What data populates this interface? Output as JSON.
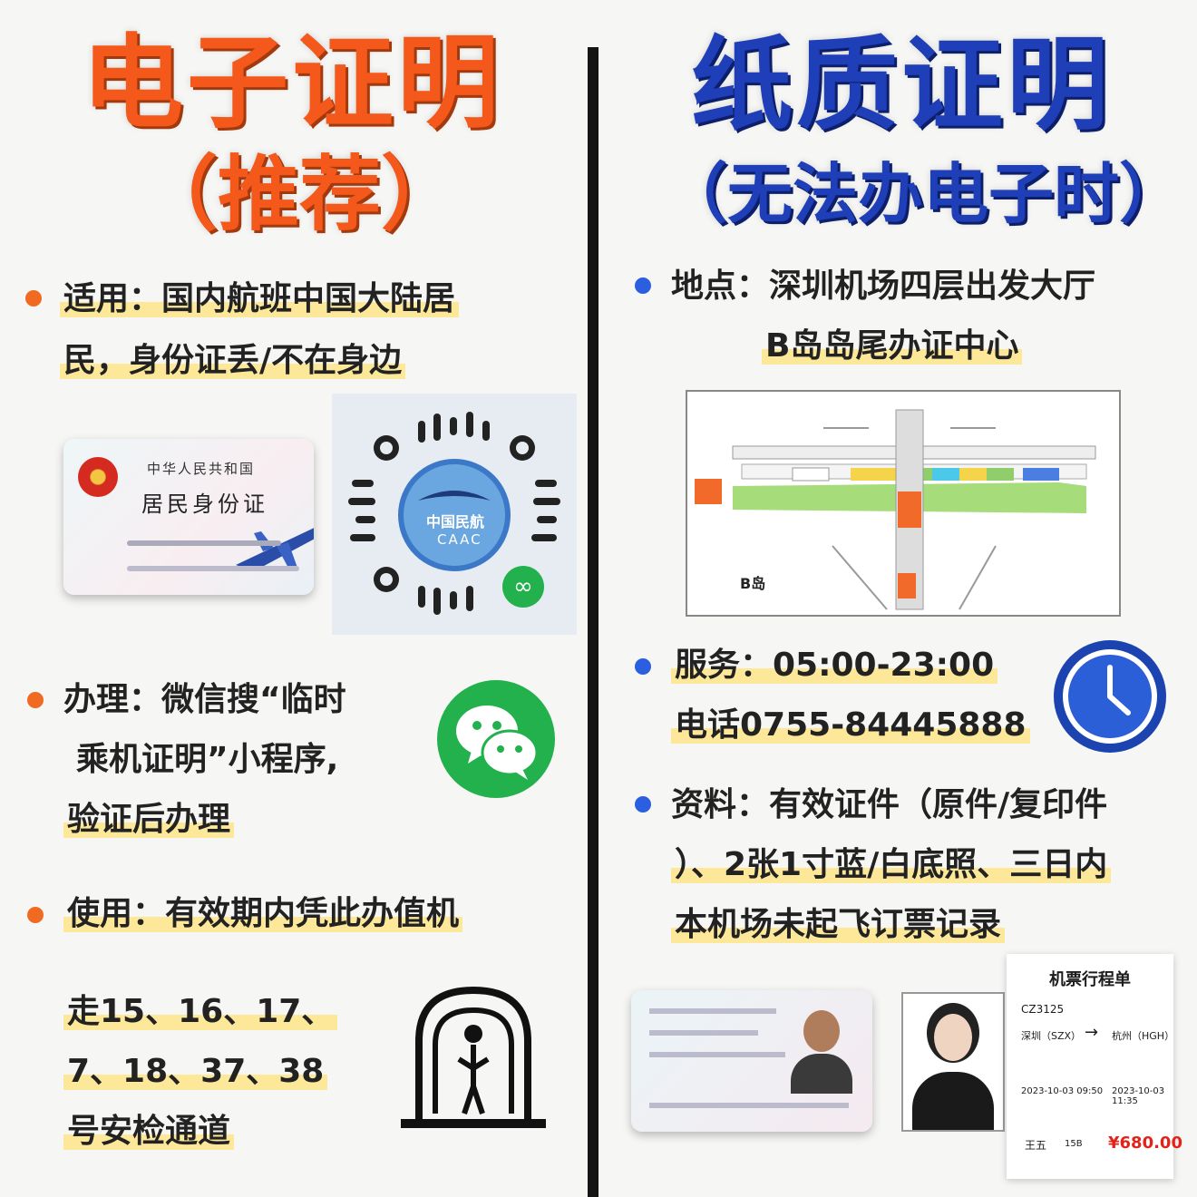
{
  "left": {
    "title": "电子证明",
    "subtitle": "（推荐）",
    "apply": {
      "line1": "适用：国内航班中国大陆居",
      "line2": "民，身份证丢/不在身边"
    },
    "idcard": {
      "country": "中华人民共和国",
      "name": "居民身份证"
    },
    "qr": {
      "logo_text": "中国民航",
      "logo_sub": "CAAC"
    },
    "process": {
      "line1": "办理：微信搜“临时",
      "line2": "乘机证明”小程序,",
      "line3": "验证后办理"
    },
    "usage": {
      "line1": "使用：有效期内凭此办值机"
    },
    "lanes": {
      "line1": "走15、16、17、",
      "line2": "7、18、37、38",
      "line3": "号安检通道"
    }
  },
  "right": {
    "title": "纸质证明",
    "subtitle": "（无法办电子时）",
    "location": {
      "line1": "地点：深圳机场四层出发大厅",
      "line2": "B岛岛尾办证中心"
    },
    "map": {
      "b_label": "B岛"
    },
    "service": {
      "line1": "服务：05:00-23:00",
      "line2": "电话0755-84445888"
    },
    "materials": {
      "line1": "资料：有效证件（原件/复印件",
      "line2": "）、2张1寸蓝/白底照、三日内",
      "line3": "本机场未起飞订票记录"
    },
    "ticket": {
      "title": "机票行程单",
      "flight": "CZ3125",
      "from": "深圳（SZX）",
      "to": "杭州（HGH）",
      "dep_time": "2023-10-03  09:50",
      "arr_time": "2023-10-03 11:35",
      "passenger": "王五",
      "seat": "15B",
      "price": "¥680.00"
    }
  },
  "colors": {
    "orange": "#f4581a",
    "blue": "#1f3fb8",
    "highlight": "#fde89a",
    "wechat": "#22b14c"
  }
}
